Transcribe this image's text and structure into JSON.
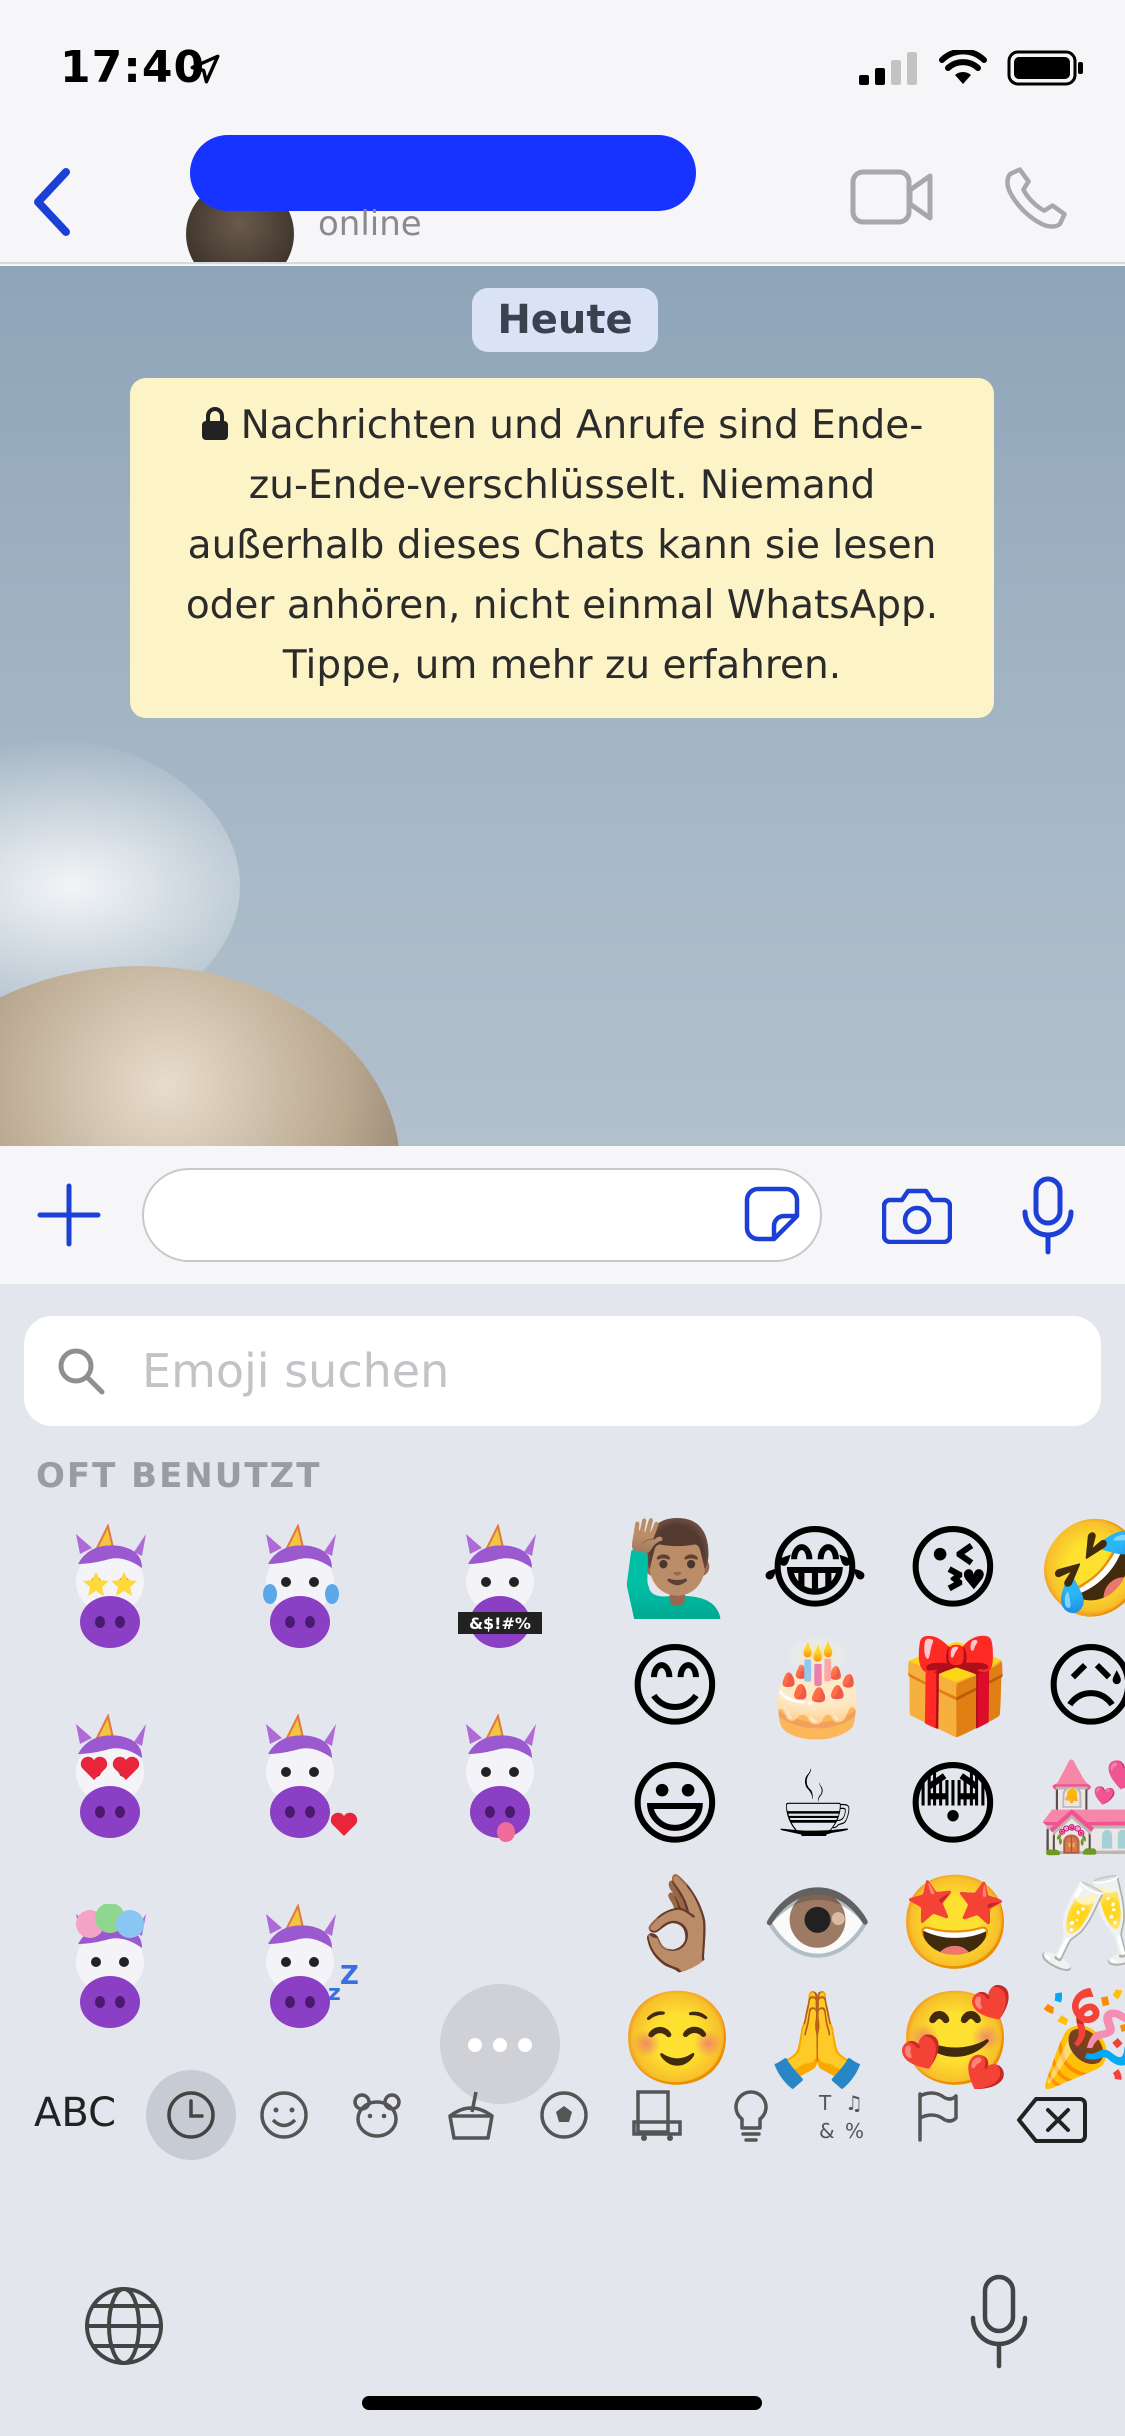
{
  "status_bar": {
    "time": "17:40"
  },
  "header": {
    "contact_status": "online"
  },
  "chat": {
    "date_chip": "Heute",
    "encryption_notice_lines": [
      "Nachrichten und Anrufe sind Ende-",
      "zu-Ende-verschlüsselt. Niemand",
      "außerhalb dieses Chats kann sie lesen",
      "oder anhören, nicht einmal WhatsApp.",
      "Tippe, um mehr zu erfahren."
    ]
  },
  "composer": {
    "message_value": ""
  },
  "keyboard": {
    "search_placeholder": "Emoji suchen",
    "section_label": "OFT BENUTZT",
    "memoji_sticker_text": "&$!#%",
    "emojis": [
      "🙋🏽‍♂️",
      "😂",
      "😘",
      "🤣",
      "😊",
      "🎂",
      "🎁",
      "😥",
      "😃",
      "☕",
      "😳",
      "💒",
      "👌🏽",
      "👁️",
      "🤩",
      "🥂",
      "☺️",
      "🙏",
      "🥰",
      "🎉"
    ],
    "abc_label": "ABC",
    "categories": [
      "recents-icon",
      "smiley-icon",
      "animals-icon",
      "food-icon",
      "activity-icon",
      "travel-icon",
      "objects-icon",
      "symbols-icon",
      "flags-icon"
    ]
  },
  "colors": {
    "accent": "#1c3fd6",
    "redaction": "#1633ff",
    "notice_bg": "#fcf3c6"
  }
}
